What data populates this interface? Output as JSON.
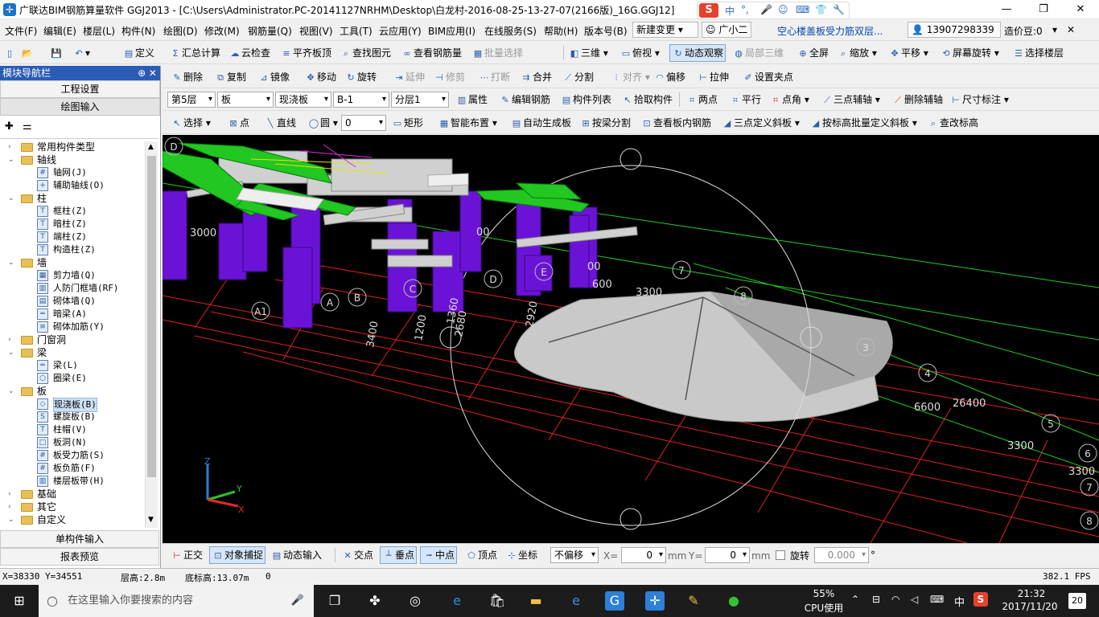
{
  "window": {
    "title": "广联达BIM钢筋算量软件 GGJ2013 - [C:\\Users\\Administrator.PC-20141127NRHM\\Desktop\\白龙村-2016-08-25-13-27-07(2166版)_16G.GGJ12]",
    "controls": {
      "minimize": "—",
      "restore": "❐",
      "close": "✕"
    }
  },
  "ime_bar": {
    "logo": "S",
    "mode": "中",
    "punct": "°,"
  },
  "menu": {
    "items": [
      "文件(F)",
      "编辑(E)",
      "楼层(L)",
      "构件(N)",
      "绘图(D)",
      "修改(M)",
      "钢筋量(Q)",
      "视图(V)",
      "工具(T)",
      "云应用(Y)",
      "BIM应用(I)",
      "在线服务(S)",
      "帮助(H)",
      "版本号(B)"
    ],
    "new_change": "新建变更",
    "assistant": "广小二",
    "notice": "空心楼盖板受力筋双层...",
    "phone": "13907298339",
    "price_bean": "造价豆:0"
  },
  "toolbar1": {
    "items": [
      "定义",
      "汇总计算",
      "云检查",
      "平齐板顶",
      "查找图元",
      "查看钢筋量",
      "批量选择",
      "三维",
      "俯视",
      "动态观察",
      "局部三维",
      "全屏",
      "缩放",
      "平移",
      "屏幕旋转",
      "选择楼层"
    ]
  },
  "toolbar2": {
    "items": [
      "删除",
      "复制",
      "镜像",
      "移动",
      "旋转",
      "延伸",
      "修剪",
      "打断",
      "合并",
      "分割",
      "对齐",
      "偏移",
      "拉伸",
      "设置夹点"
    ]
  },
  "toolbar3": {
    "floor": "第5层",
    "type": "板",
    "subtype": "现浇板",
    "name": "B-1",
    "layer": "分层1",
    "items": [
      "属性",
      "编辑钢筋",
      "构件列表",
      "拾取构件",
      "两点",
      "平行",
      "点角",
      "三点辅轴",
      "删除辅轴",
      "尺寸标注"
    ]
  },
  "toolbar4": {
    "select": "选择",
    "point": "点",
    "line": "直线",
    "circle": "圆",
    "value": "0",
    "items": [
      "矩形",
      "智能布置",
      "自动生成板",
      "按梁分割",
      "查看板内钢筋",
      "三点定义斜板",
      "按标高批量定义斜板",
      "查改标高"
    ]
  },
  "nav_panel": {
    "title": "模块导航栏",
    "pin": "⊕ ✕",
    "btn_project": "工程设置",
    "btn_draw": "绘图输入",
    "btn_single": "单构件输入",
    "btn_report": "报表预览",
    "tree": [
      {
        "label": "常用构件类型",
        "type": "folder",
        "exp": "›"
      },
      {
        "label": "轴线",
        "type": "folder",
        "exp": "⌄"
      },
      {
        "label": "轴网(J)",
        "type": "child",
        "icon": "#"
      },
      {
        "label": "辅助轴线(O)",
        "type": "child",
        "icon": "+"
      },
      {
        "label": "柱",
        "type": "folder",
        "exp": "⌄"
      },
      {
        "label": "框柱(Z)",
        "type": "child",
        "icon": "T"
      },
      {
        "label": "暗柱(Z)",
        "type": "child",
        "icon": "T"
      },
      {
        "label": "端柱(Z)",
        "type": "child",
        "icon": "T"
      },
      {
        "label": "构造柱(Z)",
        "type": "child",
        "icon": "T"
      },
      {
        "label": "墙",
        "type": "folder",
        "exp": "⌄"
      },
      {
        "label": "剪力墙(Q)",
        "type": "child",
        "icon": "▦"
      },
      {
        "label": "人防门框墙(RF)",
        "type": "child",
        "icon": "▥"
      },
      {
        "label": "砌体墙(Q)",
        "type": "child",
        "icon": "▤"
      },
      {
        "label": "暗梁(A)",
        "type": "child",
        "icon": "═"
      },
      {
        "label": "砌体加筋(Y)",
        "type": "child",
        "icon": "≡"
      },
      {
        "label": "门窗洞",
        "type": "folder",
        "exp": "›"
      },
      {
        "label": "梁",
        "type": "folder",
        "exp": "⌄"
      },
      {
        "label": "梁(L)",
        "type": "child",
        "icon": "═"
      },
      {
        "label": "圈梁(E)",
        "type": "child",
        "icon": "○"
      },
      {
        "label": "板",
        "type": "folder",
        "exp": "⌄"
      },
      {
        "label": "现浇板(B)",
        "type": "child",
        "icon": "◇",
        "selected": true
      },
      {
        "label": "螺旋板(B)",
        "type": "child",
        "icon": "S"
      },
      {
        "label": "柱帽(V)",
        "type": "child",
        "icon": "T"
      },
      {
        "label": "板洞(N)",
        "type": "child",
        "icon": "□"
      },
      {
        "label": "板受力筋(S)",
        "type": "child",
        "icon": "#"
      },
      {
        "label": "板负筋(F)",
        "type": "child",
        "icon": "#"
      },
      {
        "label": "楼层板带(H)",
        "type": "child",
        "icon": "▥"
      },
      {
        "label": "基础",
        "type": "folder",
        "exp": "›"
      },
      {
        "label": "其它",
        "type": "folder",
        "exp": "›"
      },
      {
        "label": "自定义",
        "type": "folder",
        "exp": "⌄"
      }
    ]
  },
  "viewport_labels": {
    "axis_numbers": [
      "7",
      "8",
      "3",
      "4",
      "5",
      "6",
      "7",
      "8"
    ],
    "axis_letters": [
      "D",
      "A1",
      "A",
      "B",
      "C",
      "D",
      "E"
    ],
    "dims": [
      "3000",
      "3400",
      "1200",
      "1360",
      "2680",
      "2920",
      "3300",
      "600",
      "6600",
      "26400",
      "3300",
      "3300",
      "00",
      "00"
    ],
    "coord_axes": [
      "Z",
      "Y",
      "X"
    ]
  },
  "bottombar": {
    "items": [
      "正交",
      "对象捕捉",
      "动态输入",
      "交点",
      "垂点",
      "中点",
      "顶点",
      "坐标"
    ],
    "offset": "不偏移",
    "x_label": "X=",
    "x_value": "0",
    "x_unit": "mm",
    "y_label": "Y=",
    "y_value": "0",
    "y_unit": "mm",
    "rotate_label": "旋转",
    "rotate_value": "0.000",
    "rotate_unit": "°"
  },
  "statusbar": {
    "coords": "X=38330 Y=34551",
    "floor_height": "层高:2.8m",
    "base_elev": "底标高:13.07m",
    "zero": "0",
    "fps": "382.1 FPS"
  },
  "taskbar": {
    "search_placeholder": "在这里输入你要搜索的内容",
    "cpu_percent": "55%",
    "cpu_label": "CPU使用",
    "ime": "中",
    "time": "21:32",
    "date": "2017/11/20",
    "notifications": "20"
  }
}
